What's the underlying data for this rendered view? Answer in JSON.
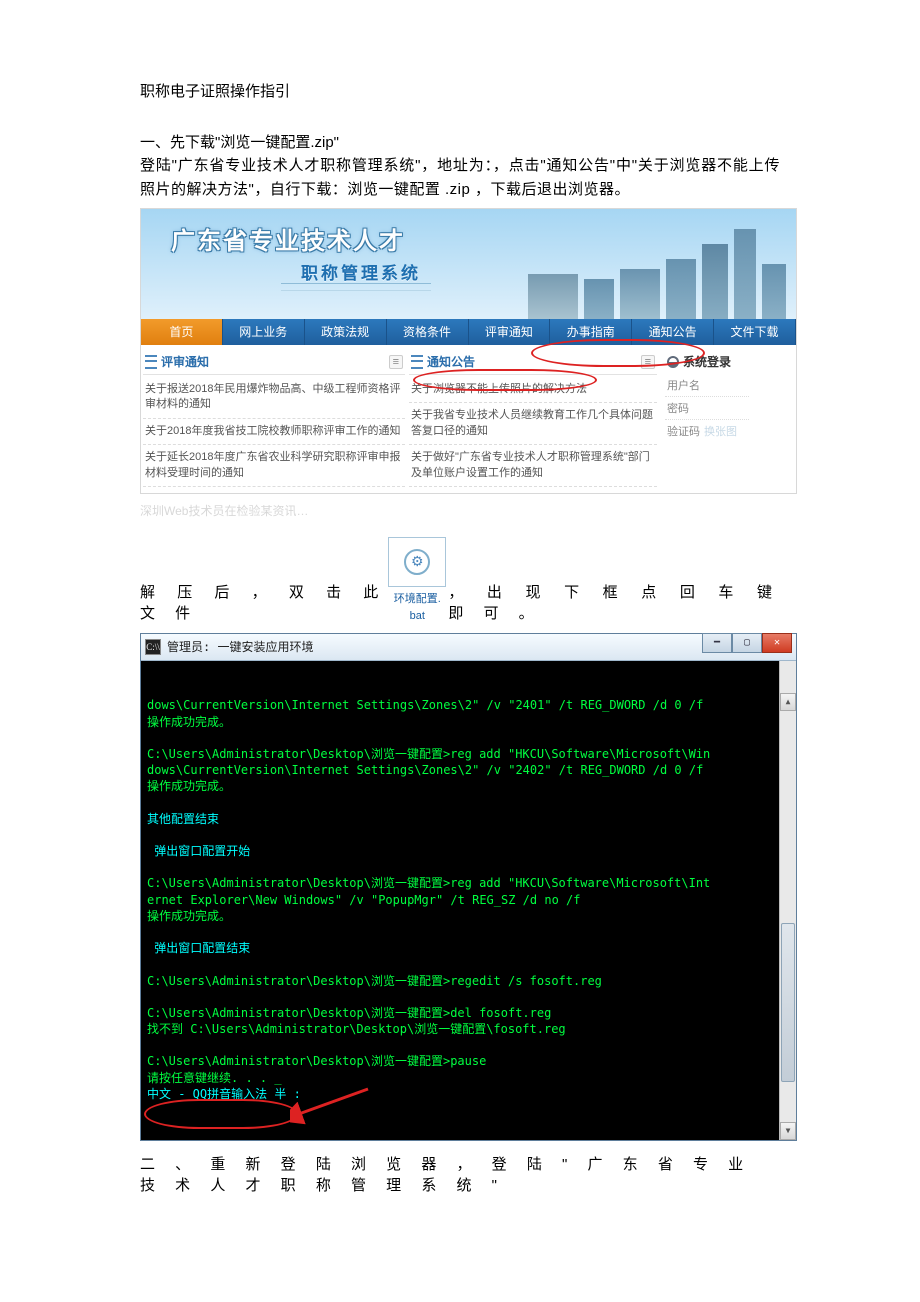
{
  "doc": {
    "title": "职称电子证照操作指引",
    "step1_head": "一、先下载\"浏览一键配置.zip\"",
    "step1_para": "登陆\"广东省专业技术人才职称管理系统\"，地址为：，点击\"通知公告\"中\"关于浏览器不能上传照片的解决方法\"，自行下载：浏览一键配置 .zip ，下载后退出浏览器。",
    "faded": "深圳Web技术员在检验某资讯…",
    "after_unzip_left": "解 压 后 ， 双 击 此 文 件",
    "after_unzip_right": "， 出 现 下 框 点 回 车 键 即 可 。",
    "bat_label_top": "环境配置.",
    "bat_label_bot": "bat",
    "step2": "二 、 重 新 登 陆 浏 览 器 ， 登 陆 \" 广 东 省 专 业 技 术 人 才 职 称 管 理 系 统 \""
  },
  "portal": {
    "banner_title": "广东省专业技术人才",
    "banner_sub": "职称管理系统",
    "nav": [
      "首页",
      "网上业务",
      "政策法规",
      "资格条件",
      "评审通知",
      "办事指南",
      "通知公告",
      "文件下载"
    ],
    "left_head": "评审通知",
    "left_items": [
      "关于报送2018年民用爆炸物品高、中级工程师资格评审材料的通知",
      "关于2018年度我省技工院校教师职称评审工作的通知",
      "关于延长2018年度广东省农业科学研究职称评审申报材料受理时间的通知"
    ],
    "mid_head": "通知公告",
    "mid_items": [
      "关于浏览器不能上传照片的解决方法",
      "关于我省专业技术人员继续教育工作几个具体问题答复口径的通知",
      "关于做好\"广东省专业技术人才职称管理系统\"部门及单位账户设置工作的通知"
    ],
    "login_head": "系统登录",
    "login_user": "用户名",
    "login_pass": "密码",
    "login_captcha": "验证码",
    "login_refresh": "换张图"
  },
  "console": {
    "title": "管理员:  一键安装应用环境",
    "lines": [
      {
        "t": "dows\\CurrentVersion\\Internet Settings\\Zones\\2\" /v \"2401\" /t REG_DWORD /d 0 /f",
        "c": "g"
      },
      {
        "t": "操作成功完成。",
        "c": "g"
      },
      {
        "t": "",
        "c": "g"
      },
      {
        "t": "C:\\Users\\Administrator\\Desktop\\浏览一键配置>reg add \"HKCU\\Software\\Microsoft\\Win",
        "c": "g"
      },
      {
        "t": "dows\\CurrentVersion\\Internet Settings\\Zones\\2\" /v \"2402\" /t REG_DWORD /d 0 /f",
        "c": "g"
      },
      {
        "t": "操作成功完成。",
        "c": "g"
      },
      {
        "t": "",
        "c": "g"
      },
      {
        "t": "其他配置结束",
        "c": "cy"
      },
      {
        "t": "",
        "c": "g"
      },
      {
        "t": " 弹出窗口配置开始",
        "c": "cy"
      },
      {
        "t": "",
        "c": "g"
      },
      {
        "t": "C:\\Users\\Administrator\\Desktop\\浏览一键配置>reg add \"HKCU\\Software\\Microsoft\\Int",
        "c": "g"
      },
      {
        "t": "ernet Explorer\\New Windows\" /v \"PopupMgr\" /t REG_SZ /d no /f",
        "c": "g"
      },
      {
        "t": "操作成功完成。",
        "c": "g"
      },
      {
        "t": "",
        "c": "g"
      },
      {
        "t": " 弹出窗口配置结束",
        "c": "cy"
      },
      {
        "t": "",
        "c": "g"
      },
      {
        "t": "C:\\Users\\Administrator\\Desktop\\浏览一键配置>regedit /s fosoft.reg",
        "c": "g"
      },
      {
        "t": "",
        "c": "g"
      },
      {
        "t": "C:\\Users\\Administrator\\Desktop\\浏览一键配置>del fosoft.reg",
        "c": "g"
      },
      {
        "t": "找不到 C:\\Users\\Administrator\\Desktop\\浏览一键配置\\fosoft.reg",
        "c": "g"
      },
      {
        "t": "",
        "c": "g"
      },
      {
        "t": "C:\\Users\\Administrator\\Desktop\\浏览一键配置>pause",
        "c": "g"
      },
      {
        "t": "请按任意键继续. . . _",
        "c": "g"
      },
      {
        "t": "中文 - QQ拼音输入法 半 :",
        "c": "cy"
      }
    ]
  }
}
